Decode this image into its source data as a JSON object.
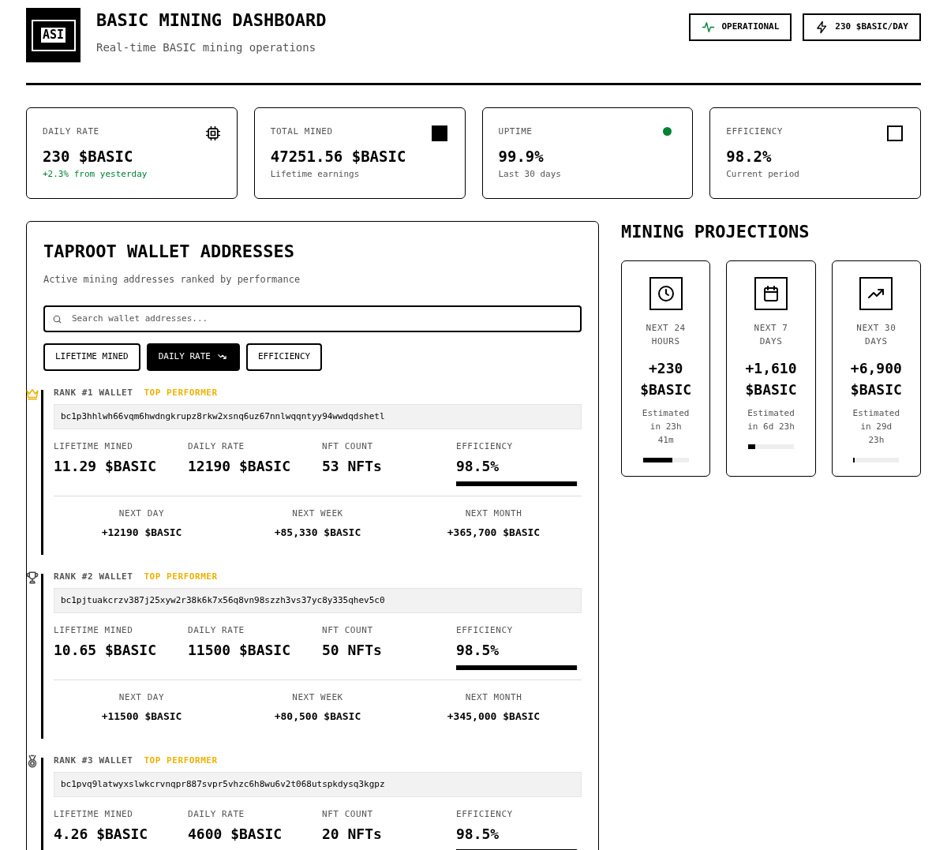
{
  "header": {
    "logo_text": "ASI",
    "title": "BASIC MINING DASHBOARD",
    "subtitle": "Real-time BASIC mining operations",
    "badges": [
      {
        "kind": "pulse",
        "label": "OPERATIONAL"
      },
      {
        "kind": "bolt",
        "label": "230 $BASIC/DAY"
      }
    ]
  },
  "stats": [
    {
      "kind": "chip",
      "label": "DAILY RATE",
      "value": "230 $BASIC",
      "note": "+2.3% from yesterday",
      "positive": true
    },
    {
      "kind": "filled_square",
      "label": "TOTAL MINED",
      "value": "47251.56 $BASIC",
      "note": "Lifetime earnings",
      "positive": false
    },
    {
      "kind": "dot",
      "label": "UPTIME",
      "value": "99.9%",
      "note": "Last 30 days",
      "positive": false
    },
    {
      "kind": "empty_square",
      "label": "EFFICIENCY",
      "value": "98.2%",
      "note": "Current period",
      "positive": false
    }
  ],
  "wallets_panel": {
    "title": "TAPROOT WALLET ADDRESSES",
    "subtitle": "Active mining addresses ranked by performance",
    "search": {
      "placeholder": "Search wallet addresses..."
    },
    "sort_buttons": [
      {
        "label": "LIFETIME MINED",
        "selected": false
      },
      {
        "label": "DAILY RATE",
        "selected": true
      },
      {
        "label": "EFFICIENCY",
        "selected": false
      }
    ],
    "wallets": [
      {
        "kind": "crown",
        "rank": "RANK #1 WALLET",
        "tag": "TOP PERFORMER",
        "address": "bc1p3hhlwh66vqm6hwdngkrupz8rkw2xsnq6uz67nnlwqqntyy94wwdqdshetl",
        "metrics": [
          {
            "label": "LIFETIME MINED",
            "value": "11.29 $BASIC"
          },
          {
            "label": "DAILY RATE",
            "value": "12190 $BASIC"
          },
          {
            "label": "NFT COUNT",
            "value": "53 NFTs"
          }
        ],
        "efficiency": {
          "label": "EFFICIENCY",
          "value": "98.5%",
          "level": 0.985
        },
        "projections": [
          {
            "label": "NEXT DAY",
            "value": "+12190 $BASIC"
          },
          {
            "label": "NEXT WEEK",
            "value": "+85,330 $BASIC"
          },
          {
            "label": "NEXT MONTH",
            "value": "+365,700 $BASIC"
          }
        ]
      },
      {
        "kind": "trophy",
        "rank": "RANK #2 WALLET",
        "tag": "TOP PERFORMER",
        "address": "bc1pjtuakcrzv387j25xyw2r38k6k7x56q8vn98szzh3vs37yc8y335qhev5c0",
        "metrics": [
          {
            "label": "LIFETIME MINED",
            "value": "10.65 $BASIC"
          },
          {
            "label": "DAILY RATE",
            "value": "11500 $BASIC"
          },
          {
            "label": "NFT COUNT",
            "value": "50 NFTs"
          }
        ],
        "efficiency": {
          "label": "EFFICIENCY",
          "value": "98.5%",
          "level": 0.985
        },
        "projections": [
          {
            "label": "NEXT DAY",
            "value": "+11500 $BASIC"
          },
          {
            "label": "NEXT WEEK",
            "value": "+80,500 $BASIC"
          },
          {
            "label": "NEXT MONTH",
            "value": "+345,000 $BASIC"
          }
        ]
      },
      {
        "kind": "medal",
        "rank": "RANK #3 WALLET",
        "tag": "TOP PERFORMER",
        "address": "bc1pvq9latwyxslwkcrvnqpr887svpr5vhzc6h8wu6v2t068utspkdysq3kgpz",
        "metrics": [
          {
            "label": "LIFETIME MINED",
            "value": "4.26 $BASIC"
          },
          {
            "label": "DAILY RATE",
            "value": "4600 $BASIC"
          },
          {
            "label": "NFT COUNT",
            "value": "20 NFTs"
          }
        ],
        "efficiency": {
          "label": "EFFICIENCY",
          "value": "98.5%",
          "level": 0.985
        }
      }
    ]
  },
  "projections_panel": {
    "title": "MINING PROJECTIONS",
    "cards": [
      {
        "kind": "clock",
        "label": "NEXT 24 HOURS",
        "value": "+230 $BASIC",
        "note": "Estimated in 23h 41m",
        "level": 0.65
      },
      {
        "kind": "calendar",
        "label": "NEXT 7 DAYS",
        "value": "+1,610 $BASIC",
        "note": "Estimated in 6d 23h",
        "level": 0.15
      },
      {
        "kind": "trend",
        "label": "NEXT 30 DAYS",
        "value": "+6,900 $BASIC",
        "note": "Estimated in 29d 23h",
        "level": 0.03
      }
    ]
  }
}
